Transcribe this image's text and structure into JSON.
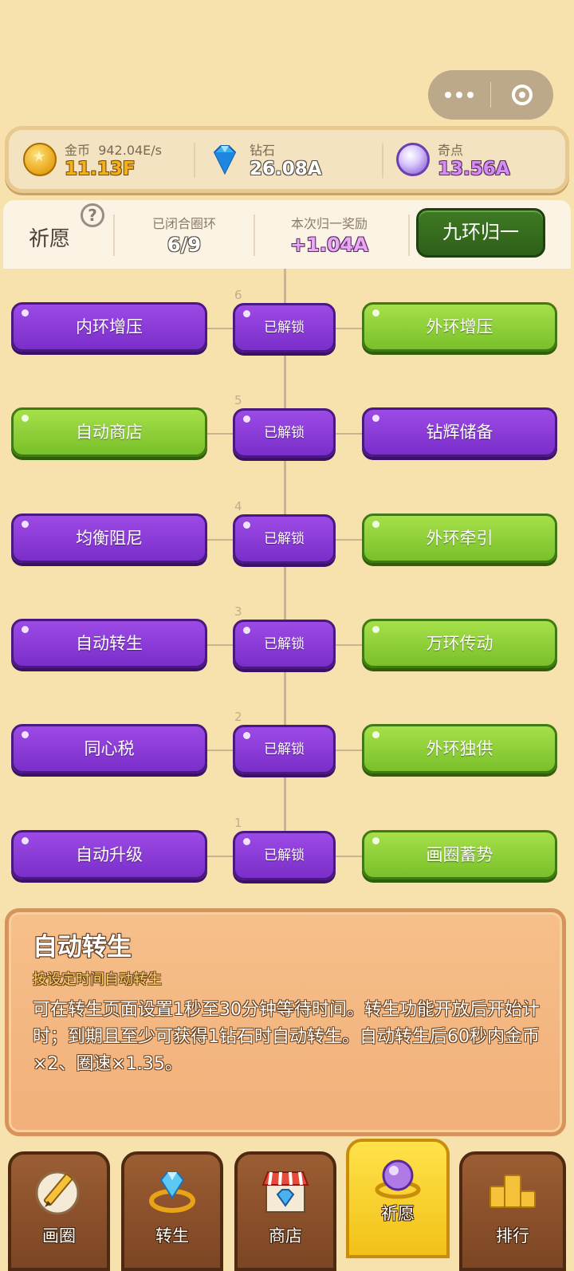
{
  "currency": {
    "coin": {
      "label": "金币",
      "rate": "942.04E/s",
      "value": "11.13F"
    },
    "diamond": {
      "label": "钻石",
      "value": "26.08A"
    },
    "odd_point": {
      "label": "奇点",
      "value": "13.56A"
    }
  },
  "wish": {
    "title": "祈愿",
    "help": "?",
    "closed_rings_label": "已闭合圈环",
    "closed_rings_value": "6/9",
    "reward_label": "本次归一奖励",
    "reward_value": "+1.04A",
    "unify_button": "九环归一"
  },
  "tree": {
    "rows": [
      {
        "level": "6",
        "left": "内环增压",
        "center": "已解锁",
        "right": "外环增压"
      },
      {
        "level": "5",
        "left": "自动商店",
        "center": "已解锁",
        "right": "钻辉储备"
      },
      {
        "level": "4",
        "left": "均衡阻尼",
        "center": "已解锁",
        "right": "外环牵引"
      },
      {
        "level": "3",
        "left": "自动转生",
        "center": "已解锁",
        "right": "万环传动"
      },
      {
        "level": "2",
        "left": "同心税",
        "center": "已解锁",
        "right": "外环独供"
      },
      {
        "level": "1",
        "left": "自动升级",
        "center": "已解锁",
        "right": "画圈蓄势"
      }
    ]
  },
  "detail": {
    "title": "自动转生",
    "subtitle": "按设定时间自动转生",
    "description": "可在转生页面设置1秒至30分钟等待时间。转生功能开放后开始计时；到期且至少可获得1钻石时自动转生。自动转生后60秒内金币×2、圈速×1.35。"
  },
  "nav": {
    "draw": "画圈",
    "rebirth": "转生",
    "shop": "商店",
    "wish": "祈愿",
    "rank": "排行"
  },
  "colors": {
    "background": "#f7e2ad",
    "purple_node": "#8a3ad6",
    "green_node": "#8fd038",
    "coin_value": "#f0b020",
    "diamond_value": "#6a5e54",
    "odd_value": "#c47ae0"
  }
}
